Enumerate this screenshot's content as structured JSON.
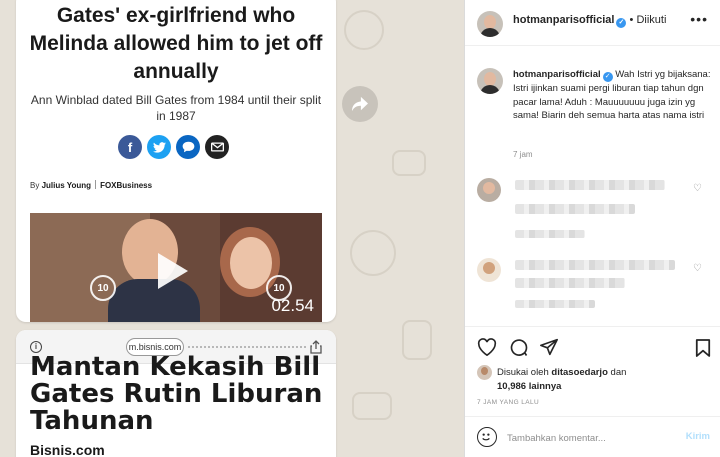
{
  "left_media": {
    "card1": {
      "headline": "Gates' ex-girlfriend who Melinda allowed him to jet off annually",
      "subheadline": "Ann Winblad dated Bill Gates from 1984 until their split in 1987",
      "share_icons": [
        "facebook-icon",
        "twitter-icon",
        "comment-icon",
        "email-icon"
      ],
      "byline_prefix": "By",
      "author": "Julius Young",
      "outlet": "FOXBusiness",
      "video": {
        "duration": "02.54",
        "rewind_label": "10",
        "forward_label": "10"
      }
    },
    "forward_button_icon": "share-forward-icon",
    "card2": {
      "url": "m.bisnis.com",
      "headline": "Mantan Kekasih Bill Gates Rutin Liburan Tahunan",
      "source": "Bisnis.com"
    }
  },
  "post": {
    "username": "hotmanparisofficial",
    "separator": "•",
    "follow_status": "Diikuti",
    "more_icon": "•••",
    "caption": {
      "username": "hotmanparisofficial",
      "text": "Wah Istri yg bijaksana: Istri ijinkan suami pergi liburan tiap tahun dgn pacar lama! Aduh : Mauuuuuuu juga izin yg sama! Biarin deh semua harta atas nama istri",
      "time": "7 jam"
    },
    "liked_by": {
      "prefix": "Disukai oleh",
      "user": "ditasoedarjo",
      "conj": "dan",
      "others": "10,986 lainnya"
    },
    "timestamp": "7 JAM YANG LALU",
    "comment_placeholder": "Tambahkan komentar...",
    "post_button": "Kirim"
  },
  "colors": {
    "verified": "#3897f0",
    "facebook": "#3b5998",
    "twitter": "#1da1f2",
    "comment": "#0a66c2",
    "email": "#222222",
    "post_button_disabled": "#b2dffc"
  }
}
